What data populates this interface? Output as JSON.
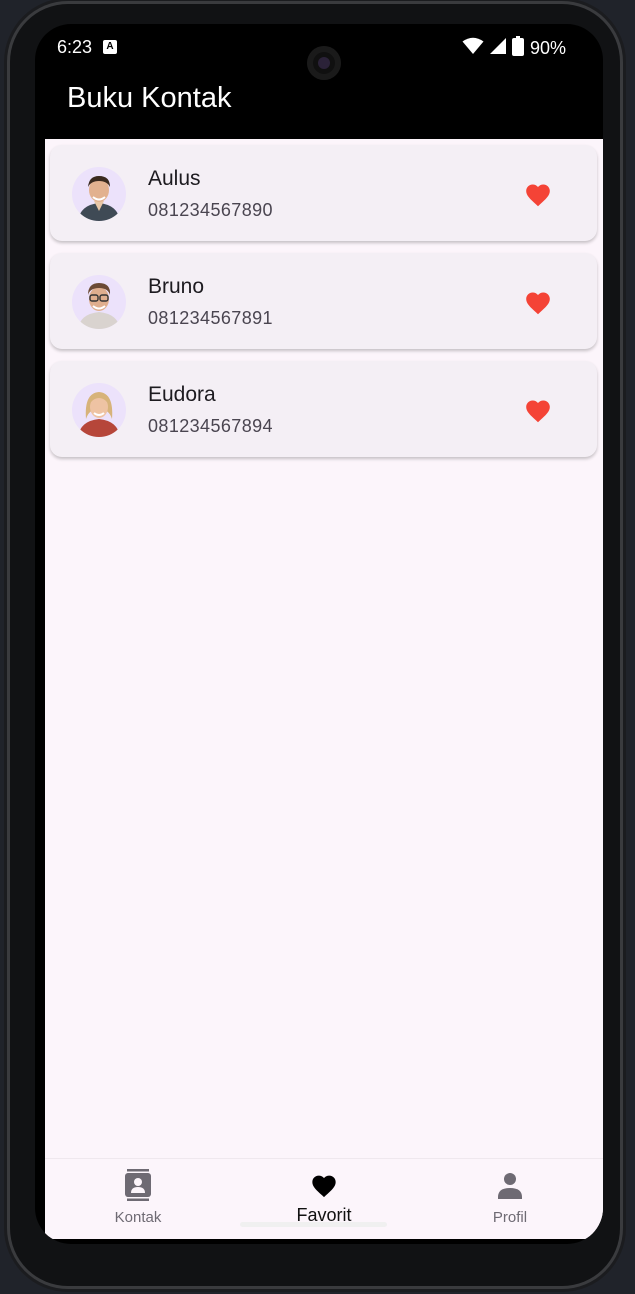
{
  "status_bar": {
    "time": "6:23",
    "notification_badge": "A",
    "battery": "90%",
    "icons": [
      "wifi-icon",
      "cellular-signal-icon",
      "battery-icon"
    ]
  },
  "app_bar": {
    "title": "Buku Kontak"
  },
  "contacts": [
    {
      "name": "Aulus",
      "phone": "081234567890",
      "favorite": true
    },
    {
      "name": "Bruno",
      "phone": "081234567891",
      "favorite": true
    },
    {
      "name": "Eudora",
      "phone": "081234567894",
      "favorite": true
    }
  ],
  "bottom_nav": {
    "items": [
      {
        "label": "Kontak",
        "icon": "contact-card-icon",
        "active": false
      },
      {
        "label": "Favorit",
        "icon": "heart-icon",
        "active": true
      },
      {
        "label": "Profil",
        "icon": "person-icon",
        "active": false
      }
    ]
  },
  "colors": {
    "heart": "#f44336",
    "app_bar": "#000000",
    "content_bg": "#fcf5fb",
    "card_bg": "#f4eff5",
    "avatar_bg": "#ece2fb"
  }
}
